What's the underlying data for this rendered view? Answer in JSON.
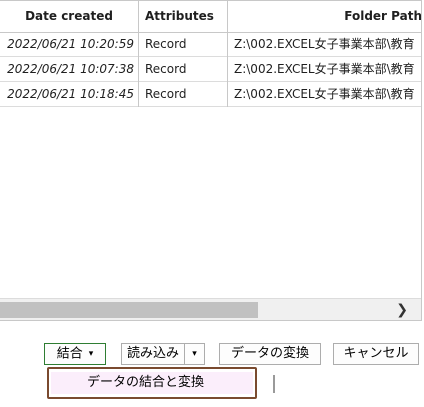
{
  "table": {
    "headers": {
      "date_created": "Date created",
      "attributes": "Attributes",
      "folder_path": "Folder Path"
    },
    "rows": [
      {
        "date_created": "2022/06/21 10:20:59",
        "attributes": "Record",
        "folder_path": "Z:\\002.EXCEL女子事業本部\\教育"
      },
      {
        "date_created": "2022/06/21 10:07:38",
        "attributes": "Record",
        "folder_path": "Z:\\002.EXCEL女子事業本部\\教育"
      },
      {
        "date_created": "2022/06/21 10:18:45",
        "attributes": "Record",
        "folder_path": "Z:\\002.EXCEL女子事業本部\\教育"
      }
    ]
  },
  "scrollbar": {
    "right_arrow": "❯"
  },
  "buttons": {
    "combine_label": "結合",
    "combine_caret": "▾",
    "load_label": "読み込み",
    "load_caret": "▾",
    "transform_label": "データの変換",
    "cancel_label": "キャンセル"
  },
  "dropdown": {
    "item_label": "データの結合と変換"
  },
  "colors": {
    "dropdown_border": "#7a4a2f",
    "dropdown_highlight": "#fbeefb",
    "combine_border": "#2e7d32"
  }
}
